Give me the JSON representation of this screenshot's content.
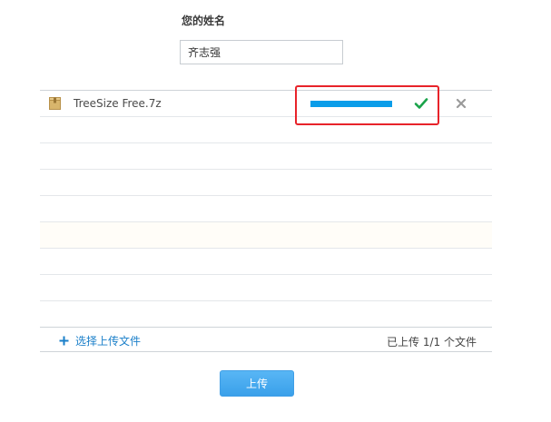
{
  "form": {
    "name_label": "您的姓名",
    "name_value": "齐志强"
  },
  "files": [
    {
      "name": "TreeSize Free.7z",
      "icon": "archive-file-icon",
      "progress": 1.0,
      "status_icon": "check-icon",
      "remove_icon": "close-icon"
    }
  ],
  "footer": {
    "add_label": "选择上传文件",
    "add_icon": "plus-icon",
    "status_text": "已上传 1/1 个文件"
  },
  "actions": {
    "upload_label": "上传"
  },
  "colors": {
    "progress": "#0b9de9",
    "success": "#1aa34a",
    "link": "#1a7fc9",
    "highlight": "#e8232a",
    "button": "#3aa0ea"
  }
}
